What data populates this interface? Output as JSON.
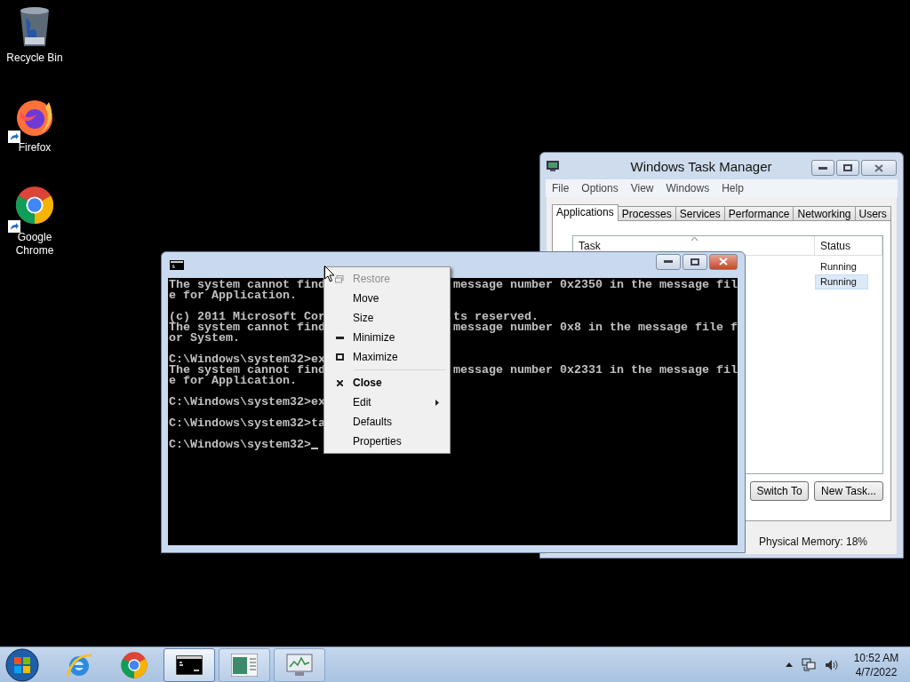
{
  "desktop_icons": [
    {
      "label": "Recycle Bin",
      "kind": "bin",
      "shortcut": false
    },
    {
      "label": "Firefox",
      "kind": "firefox",
      "shortcut": true
    },
    {
      "label": "Google Chrome",
      "kind": "chrome",
      "shortcut": true
    }
  ],
  "task_manager": {
    "title": "Windows Task Manager",
    "menu": [
      "File",
      "Options",
      "View",
      "Windows",
      "Help"
    ],
    "tabs": [
      {
        "label": "Applications",
        "selected": true
      },
      {
        "label": "Processes",
        "selected": false
      },
      {
        "label": "Services",
        "selected": false
      },
      {
        "label": "Performance",
        "selected": false
      },
      {
        "label": "Networking",
        "selected": false
      },
      {
        "label": "Users",
        "selected": false
      }
    ],
    "columns": [
      "Task",
      "Status"
    ],
    "rows": [
      {
        "status": "Running",
        "selected": false
      },
      {
        "status": "Running",
        "selected": true
      }
    ],
    "buttons": [
      "Switch To",
      "New Task..."
    ],
    "status_bar": "Physical Memory: 18%"
  },
  "console": {
    "paragraphs": [
      [
        {
          "left": "The system cannot find",
          "right": "message number 0x2350 in the message fil"
        },
        {
          "left": "e for Application."
        }
      ],
      [
        {
          "left": "(c) 2011 Microsoft Cor",
          "right": "ts reserved."
        },
        {
          "left": "The system cannot find",
          "right": "message number 0x8 in the message file f"
        },
        {
          "left": "or System."
        }
      ],
      [
        {
          "left": "C:\\Windows\\system32>ex"
        },
        {
          "left": "The system cannot find",
          "right": "message number 0x2331 in the message fil"
        },
        {
          "left": "e for Application."
        }
      ],
      [
        {
          "left": "C:\\Windows\\system32>ex"
        }
      ],
      [
        {
          "left": "C:\\Windows\\system32>ta"
        }
      ],
      [
        {
          "left": "C:\\Windows\\system32>",
          "cursor": true
        }
      ]
    ]
  },
  "context_menu": [
    {
      "label": "Restore",
      "kind": "restore",
      "disabled": true,
      "bold": false,
      "submenu": false,
      "separator_before": false
    },
    {
      "label": "Move",
      "kind": "plain",
      "disabled": false,
      "bold": false,
      "submenu": false,
      "separator_before": false
    },
    {
      "label": "Size",
      "kind": "plain",
      "disabled": false,
      "bold": false,
      "submenu": false,
      "separator_before": false
    },
    {
      "label": "Minimize",
      "kind": "minimize",
      "disabled": false,
      "bold": false,
      "submenu": false,
      "separator_before": false
    },
    {
      "label": "Maximize",
      "kind": "maximize",
      "disabled": false,
      "bold": false,
      "submenu": false,
      "separator_before": false
    },
    {
      "label": "Close",
      "kind": "close",
      "disabled": false,
      "bold": true,
      "submenu": false,
      "separator_before": true
    },
    {
      "label": "Edit",
      "kind": "plain",
      "disabled": false,
      "bold": false,
      "submenu": true,
      "separator_before": false
    },
    {
      "label": "Defaults",
      "kind": "plain",
      "disabled": false,
      "bold": false,
      "submenu": false,
      "separator_before": false
    },
    {
      "label": "Properties",
      "kind": "plain",
      "disabled": false,
      "bold": false,
      "submenu": false,
      "separator_before": false
    }
  ],
  "taskbar": {
    "pinned": [
      {
        "kind": "ie"
      },
      {
        "kind": "chrome"
      }
    ],
    "running": [
      {
        "kind": "console",
        "selected": true
      },
      {
        "kind": "taskmgr",
        "selected": false
      },
      {
        "kind": "monitor",
        "selected": false
      }
    ],
    "clock": {
      "time": "10:52 AM",
      "date": "4/7/2022"
    }
  }
}
